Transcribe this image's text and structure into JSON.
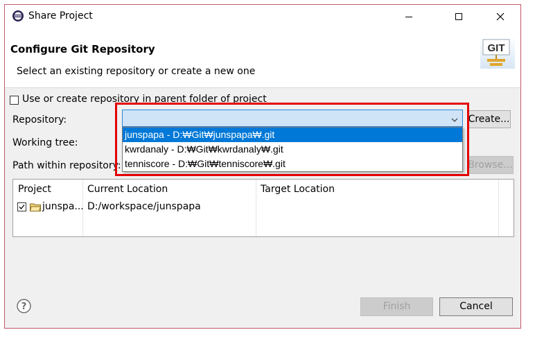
{
  "window": {
    "title": "Share Project",
    "minimize_glyph": "—",
    "maximize_glyph": "☐",
    "close_glyph": "✕"
  },
  "banner": {
    "title": "Configure Git Repository",
    "subtitle": "Select an existing repository or create a new one",
    "logo_text": "GIT"
  },
  "form": {
    "parent_folder_label": "Use or create repository in parent folder of project",
    "repository_label": "Repository:",
    "working_tree_label": "Working tree:",
    "path_label": "Path within repository:",
    "create_button": "Create...",
    "browse_button": "Browse...",
    "repository_value": "",
    "options": [
      "junspapa - D:₩Git₩junspapa₩.git",
      "kwrdanaly - D:₩Git₩kwrdanaly₩.git",
      "tenniscore - D:₩Git₩tenniscore₩.git"
    ]
  },
  "table": {
    "columns": [
      "Project",
      "Current Location",
      "Target Location"
    ],
    "rows": [
      {
        "project": "junspa...",
        "current": "D:/workspace/junspapa",
        "target": ""
      }
    ]
  },
  "footer": {
    "finish": "Finish",
    "cancel": "Cancel"
  },
  "colors": {
    "selection": "#0078d7",
    "highlight_box": "#e30000",
    "window_border": "#c25868"
  },
  "icons": {
    "app": "eclipse-icon",
    "help": "help-icon",
    "folder": "project-folder-icon"
  }
}
